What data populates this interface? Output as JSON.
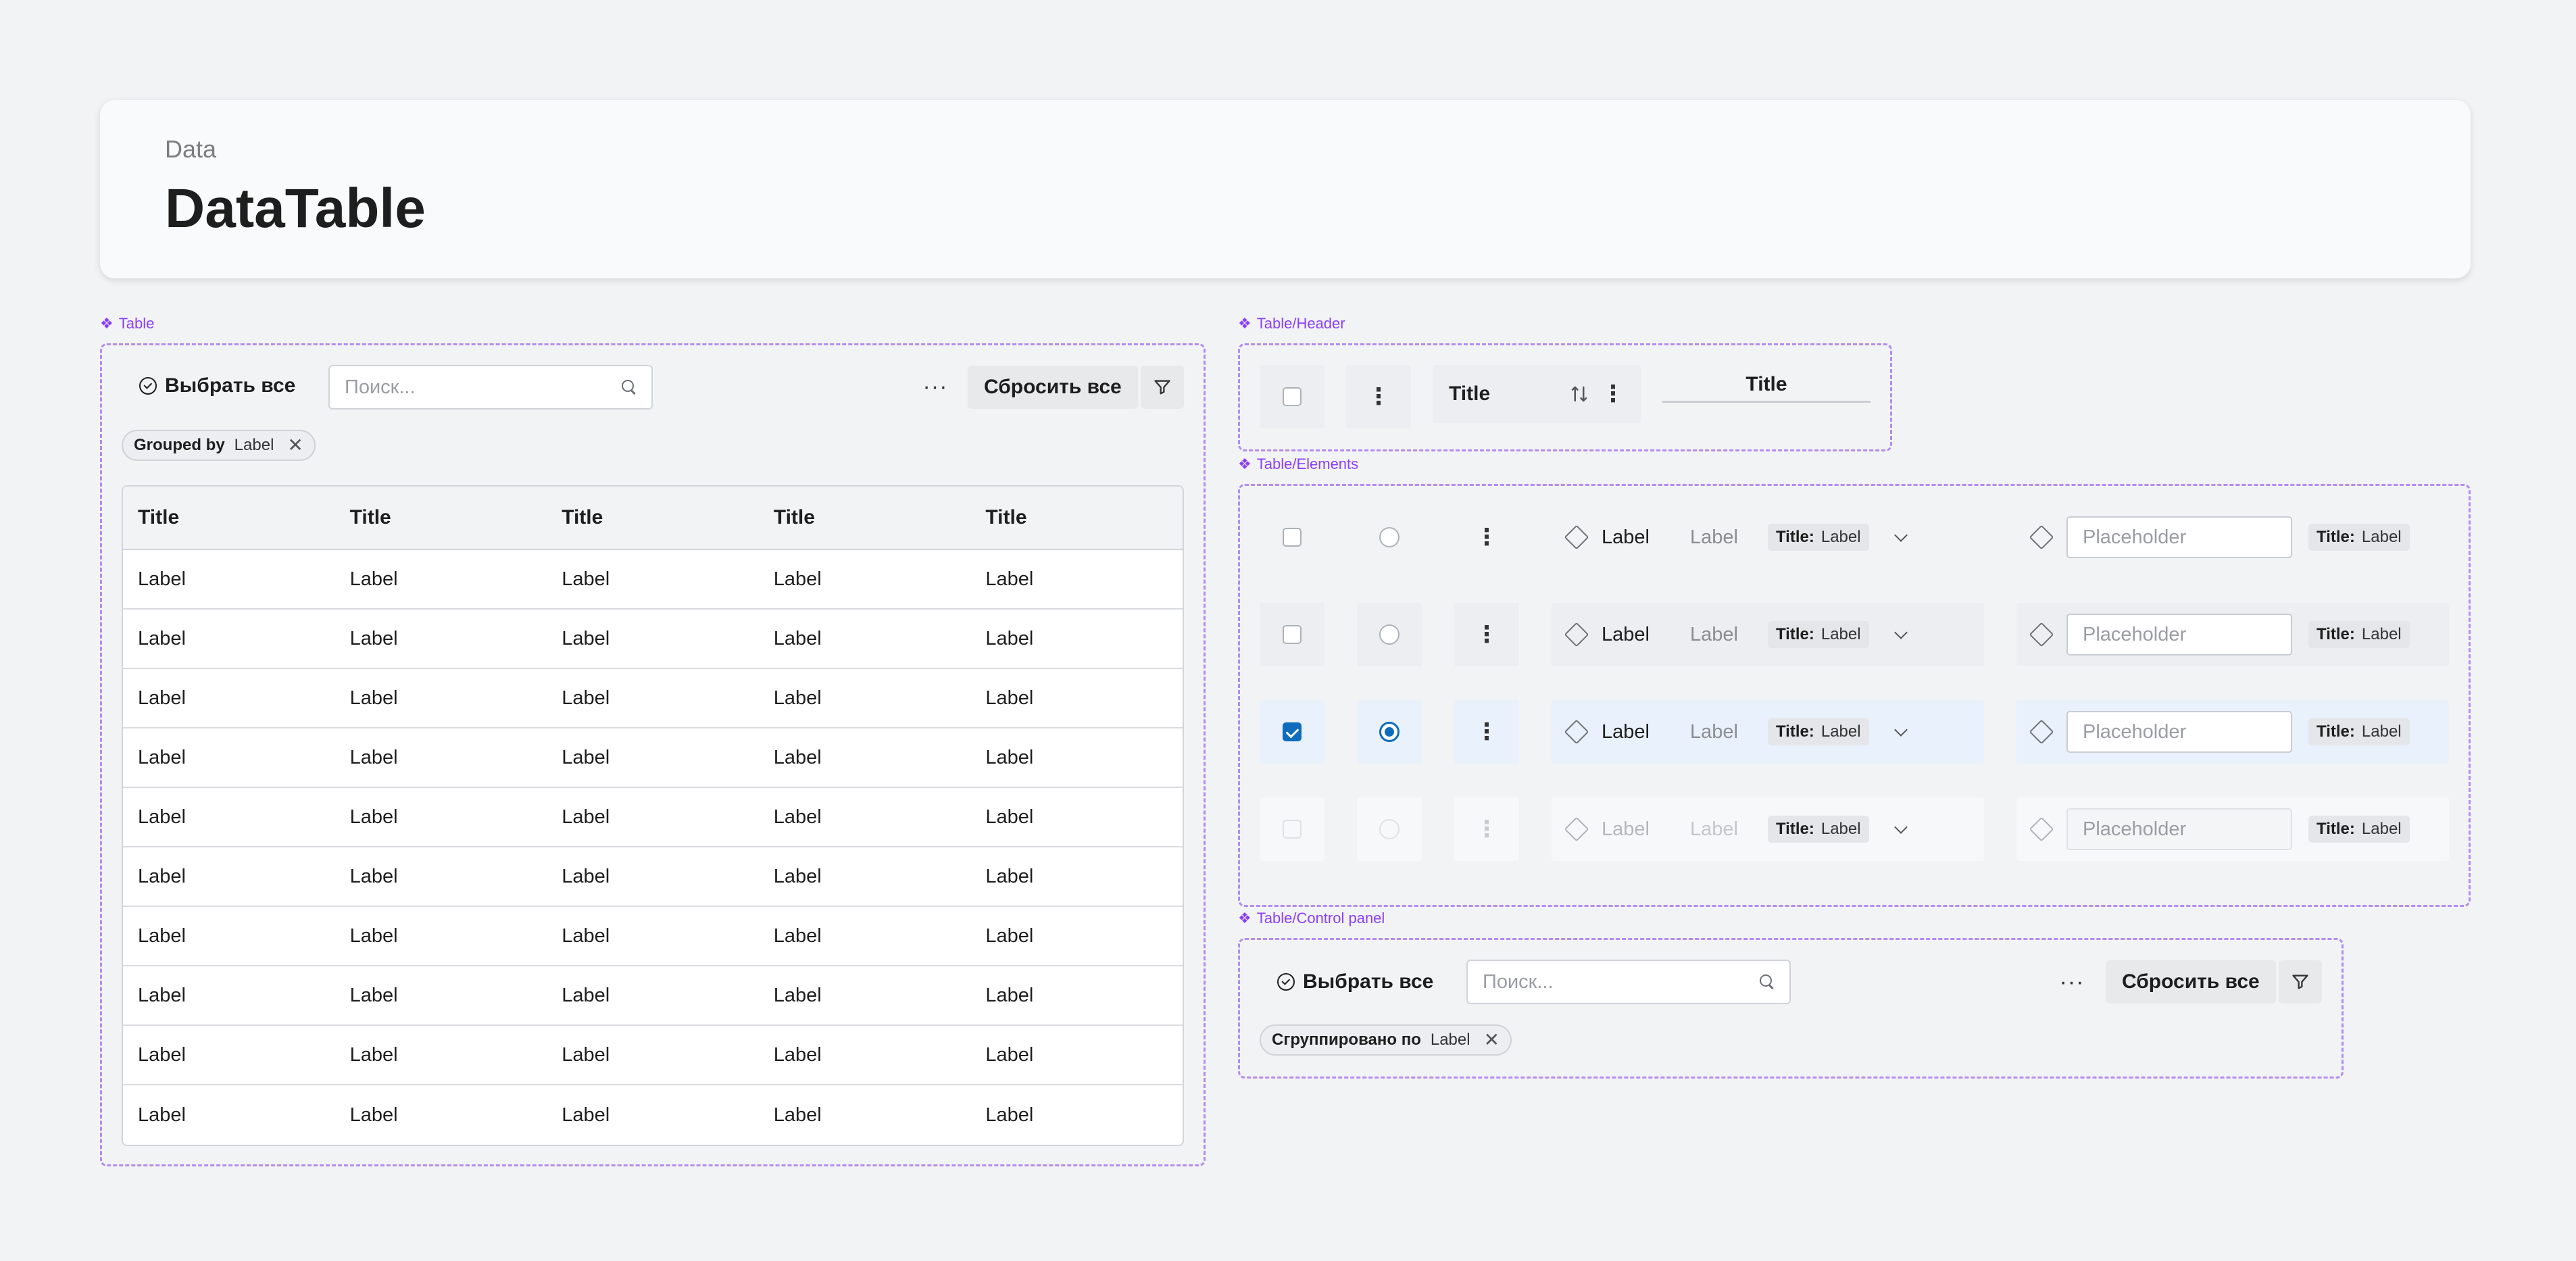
{
  "header": {
    "crumb": "Data",
    "title": "DataTable"
  },
  "frames": {
    "table": "Table",
    "table_header": "Table/Header",
    "table_elements": "Table/Elements",
    "control_panel": "Table/Control panel"
  },
  "table_panel": {
    "select_all": "Выбрать все",
    "search_placeholder": "Поиск...",
    "more": "···",
    "reset": "Сбросить все",
    "chip": {
      "key": "Grouped by",
      "value": "Label"
    },
    "columns": [
      "Title",
      "Title",
      "Title",
      "Title",
      "Title"
    ],
    "rows": [
      [
        "Label",
        "Label",
        "Label",
        "Label",
        "Label"
      ],
      [
        "Label",
        "Label",
        "Label",
        "Label",
        "Label"
      ],
      [
        "Label",
        "Label",
        "Label",
        "Label",
        "Label"
      ],
      [
        "Label",
        "Label",
        "Label",
        "Label",
        "Label"
      ],
      [
        "Label",
        "Label",
        "Label",
        "Label",
        "Label"
      ],
      [
        "Label",
        "Label",
        "Label",
        "Label",
        "Label"
      ],
      [
        "Label",
        "Label",
        "Label",
        "Label",
        "Label"
      ],
      [
        "Label",
        "Label",
        "Label",
        "Label",
        "Label"
      ],
      [
        "Label",
        "Label",
        "Label",
        "Label",
        "Label"
      ],
      [
        "Label",
        "Label",
        "Label",
        "Label",
        "Label"
      ]
    ]
  },
  "header_elements": {
    "title_sort": "Title",
    "title_plain": "Title"
  },
  "elements": {
    "label": "Label",
    "label_secondary": "Label",
    "tag_key": "Title:",
    "tag_value": "Label",
    "placeholder": "Placeholder"
  },
  "control_panel": {
    "select_all": "Выбрать все",
    "search_placeholder": "Поиск...",
    "more": "···",
    "reset": "Сбросить все",
    "chip": {
      "key": "Сгруппировано по",
      "value": "Label"
    }
  },
  "colors": {
    "accent": "#0f6cbd",
    "frame": "#b28cf2",
    "selected_row": "#e9f1fc"
  }
}
